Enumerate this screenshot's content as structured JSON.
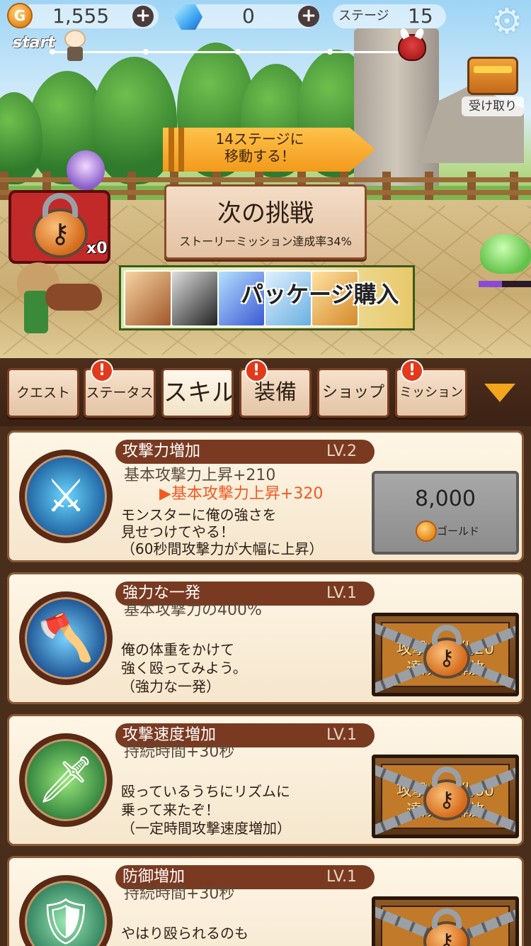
{
  "topbar": {
    "gold_value": "1,555",
    "gem_value": "0",
    "stage_label": "ステージ",
    "stage_value": "15",
    "coin_glyph": "G",
    "plus_glyph": "+",
    "gear_glyph": "⚙"
  },
  "progress": {
    "start_label": "start",
    "fraction": 0.07
  },
  "receive": {
    "label": "受け取り"
  },
  "arrow_banner": {
    "line1": "14ステージに",
    "line2": "移動する！"
  },
  "next_challenge": {
    "title": "次の挑戦",
    "subtitle": "ストーリーミッション達成率34%"
  },
  "lock_badge": {
    "count": "x0",
    "key_glyph": "⚷"
  },
  "package": {
    "label": "パッケージ購入"
  },
  "enemy": {
    "hp_fraction": 0.45
  },
  "tabs": [
    {
      "label": "クエスト",
      "alert": false
    },
    {
      "label": "ステータス",
      "alert": true
    },
    {
      "label": "スキル",
      "alert": false,
      "active": true
    },
    {
      "label": "装備",
      "alert": true
    },
    {
      "label": "ショップ",
      "alert": false
    },
    {
      "label": "ミッション",
      "alert": true
    }
  ],
  "alert_glyph": "!",
  "skills": [
    {
      "name": "攻撃力増加",
      "level": "LV.2",
      "current": "基本攻撃力上昇+210",
      "next": "▶基本攻撃力上昇+320",
      "desc": [
        "モンスターに俺の強さを",
        "見せつけてやる！",
        "（60秒間攻撃力が大幅に上昇）"
      ],
      "icon": "sword-icon",
      "icon_glyph": "⚔",
      "price": "8,000",
      "unit": "ゴールド",
      "locked": false
    },
    {
      "name": "強力な一発",
      "level": "LV.1",
      "current": "基本攻撃力の400%",
      "desc": [
        "俺の体重をかけて",
        "強く殴ってみよう。",
        "（強力な一発）"
      ],
      "icon": "axe-icon",
      "icon_glyph": "🪓",
      "lock_text": [
        "攻撃力強化20",
        "達成時解放"
      ],
      "locked": true
    },
    {
      "name": "攻撃速度増加",
      "level": "LV.1",
      "current": "持続時間+30秒",
      "desc": [
        "殴っているうちにリズムに",
        "乗って来たぞ！",
        "（一定時間攻撃速度増加）"
      ],
      "icon": "knight-icon",
      "icon_glyph": "🗡",
      "lock_text": [
        "攻撃力強化60",
        "達成時解放"
      ],
      "locked": true
    },
    {
      "name": "防御増加",
      "level": "LV.1",
      "current": "持続時間+30秒",
      "desc": [
        "やはり殴られるのも"
      ],
      "icon": "shield-icon",
      "icon_glyph": "🛡",
      "locked": true
    }
  ]
}
